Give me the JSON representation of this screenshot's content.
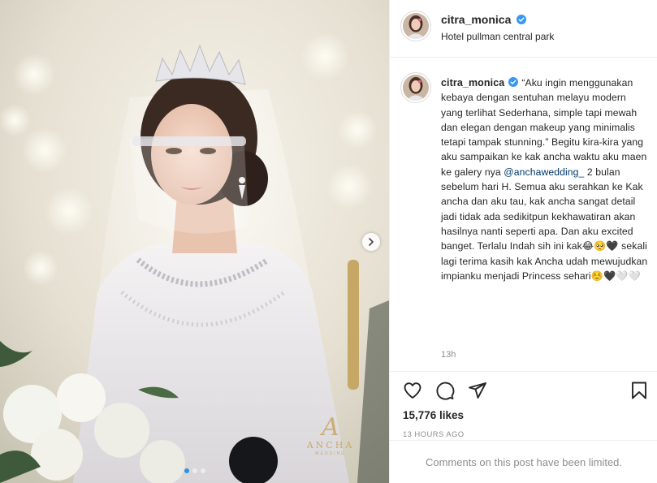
{
  "post": {
    "author": {
      "username": "citra_monica",
      "verified": true,
      "location": "Hotel pullman central park"
    },
    "caption": {
      "username": "citra_monica",
      "text_before_mention": "“Aku ingin menggunakan kebaya dengan sentuhan melayu modern yang terlihat Sederhana, simple tapi mewah dan elegan dengan makeup yang minimalis tetapi tampak stunning.” Begitu kira-kira yang aku sampaikan ke kak ancha waktu aku maen ke galery nya ",
      "mention": "@anchawedding_",
      "text_after_mention": " 2 bulan sebelum hari H. Semua aku serahkan ke Kak ancha dan aku tau, kak ancha sangat detail jadi tidak ada sedikitpun kekhawatiran akan hasilnya nanti seperti apa. Dan aku excited banget. Terlalu Indah sih ini kak😂🥺🖤 sekali lagi terima kasih kak Ancha udah mewujudkan impianku menjadi Princess sehari☺️🖤🤍🤍",
      "time_ago": "13h"
    },
    "likes": "15,776 likes",
    "date": "13 HOURS AGO",
    "comments_notice": "Comments on this post have been limited.",
    "watermark": {
      "mark": "A",
      "brand": "ANCHA",
      "sub": "WEDDING"
    },
    "carousel": {
      "count": 3,
      "active_index": 0
    },
    "icons": {
      "like": "heart-icon",
      "comment": "comment-icon",
      "share": "share-icon",
      "save": "bookmark-icon",
      "next": "chevron-right-icon",
      "verified": "verified-badge-icon"
    },
    "colors": {
      "verified": "#3897f0",
      "active_dot": "#2a91e6",
      "mention": "#00376b",
      "muted": "#8e8e8e"
    }
  }
}
